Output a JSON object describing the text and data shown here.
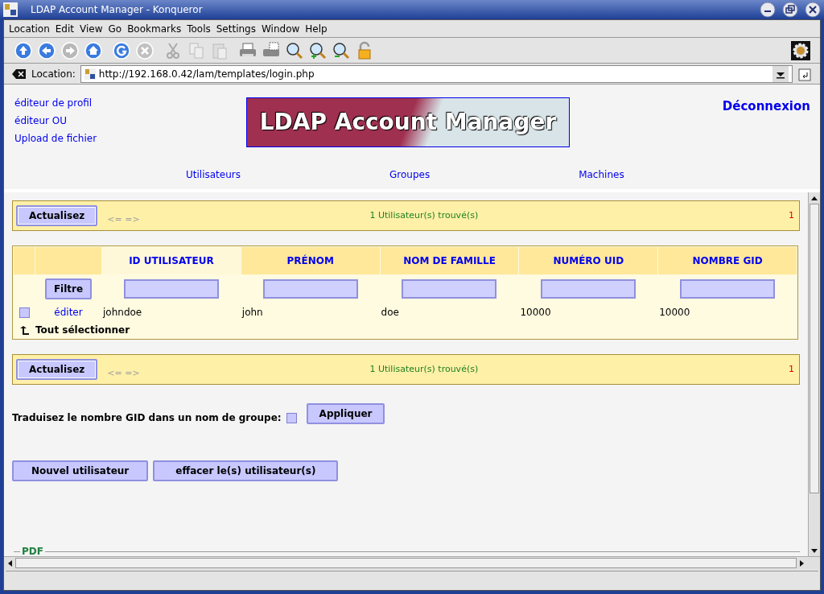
{
  "window": {
    "title": "LDAP Account Manager - Konqueror"
  },
  "menu": [
    "Location",
    "Edit",
    "View",
    "Go",
    "Bookmarks",
    "Tools",
    "Settings",
    "Window",
    "Help"
  ],
  "location": {
    "label": "Location:",
    "url": "http://192.168.0.42/lam/templates/login.php"
  },
  "top_frame": {
    "links": [
      "éditeur de profil",
      "éditeur OU",
      "Upload de fichier"
    ],
    "logo": "LDAP Account Manager",
    "logout": "Déconnexion",
    "tabs": [
      "Utilisateurs",
      "Groupes",
      "Machines"
    ]
  },
  "nav_bars": [
    {
      "button": "Actualisez",
      "arrows": "<= =>",
      "count": "1 Utilisateur(s) trouvé(s)",
      "page": "1"
    },
    {
      "button": "Actualisez",
      "arrows": "<= =>",
      "count": "1 Utilisateur(s) trouvé(s)",
      "page": "1"
    }
  ],
  "table": {
    "columns": [
      "ID UTILISATEUR",
      "PRÉNOM",
      "NOM DE FAMILLE",
      "NUMÉRO UID",
      "NOMBRE GID"
    ],
    "filter_button": "Filtre",
    "rows": [
      {
        "checked": false,
        "edit": "éditer",
        "cells": [
          "johndoe",
          "john",
          "doe",
          "10000",
          "10000"
        ]
      }
    ],
    "select_all": "Tout sélectionner"
  },
  "translate": {
    "label": "Traduisez le nombre GID dans un nom de groupe:",
    "checked": false,
    "button": "Appliquer"
  },
  "buttons": [
    "Nouvel utilisateur",
    "effacer le(s) utilisateur(s)"
  ],
  "pdf": {
    "legend": "PDF"
  }
}
